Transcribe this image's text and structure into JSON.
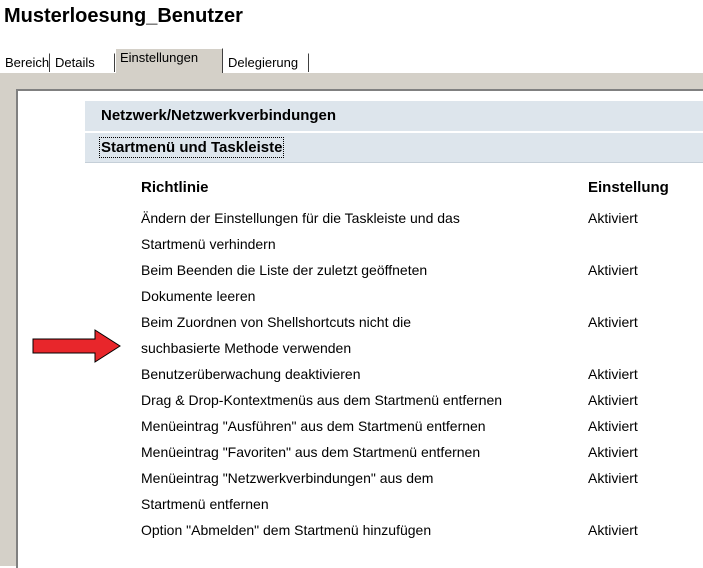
{
  "window": {
    "title": "Musterloesung_Benutzer"
  },
  "tabs": [
    {
      "label": "Bereich"
    },
    {
      "label": "Details"
    },
    {
      "label": "Einstellungen",
      "active": true
    },
    {
      "label": "Delegierung"
    }
  ],
  "sections": [
    {
      "label": "Netzwerk/Netzwerkverbindungen"
    },
    {
      "label": "Startmenü und Taskleiste",
      "focused": true
    }
  ],
  "table": {
    "headers": {
      "policy": "Richtlinie",
      "setting": "Einstellung"
    },
    "rows": [
      {
        "policy_lines": [
          "Ändern der Einstellungen für die Taskleiste und das",
          "Startmenü verhindern"
        ],
        "setting": "Aktiviert"
      },
      {
        "policy_lines": [
          "Beim Beenden die Liste der zuletzt geöffneten",
          "Dokumente leeren"
        ],
        "setting": "Aktiviert"
      },
      {
        "policy_lines": [
          "Beim Zuordnen von Shellshortcuts nicht die",
          "suchbasierte Methode verwenden"
        ],
        "setting": "Aktiviert"
      },
      {
        "policy_lines": [
          "Benutzerüberwachung deaktivieren"
        ],
        "setting": "Aktiviert"
      },
      {
        "policy_lines": [
          "Drag & Drop-Kontextmenüs aus dem Startmenü entfernen"
        ],
        "setting": "Aktiviert"
      },
      {
        "policy_lines": [
          "Menüeintrag \"Ausführen\" aus dem Startmenü entfernen"
        ],
        "setting": "Aktiviert",
        "highlighted": true
      },
      {
        "policy_lines": [
          "Menüeintrag \"Favoriten\" aus dem Startmenü entfernen"
        ],
        "setting": "Aktiviert"
      },
      {
        "policy_lines": [
          "Menüeintrag \"Netzwerkverbindungen\" aus dem",
          "Startmenü entfernen"
        ],
        "setting": "Aktiviert"
      },
      {
        "policy_lines": [
          "Option \"Abmelden\" dem Startmenü hinzufügen"
        ],
        "setting": "Aktiviert"
      }
    ]
  },
  "annotation": {
    "arrow_color": "#e8262b",
    "arrow_icon": "right-arrow-icon"
  }
}
